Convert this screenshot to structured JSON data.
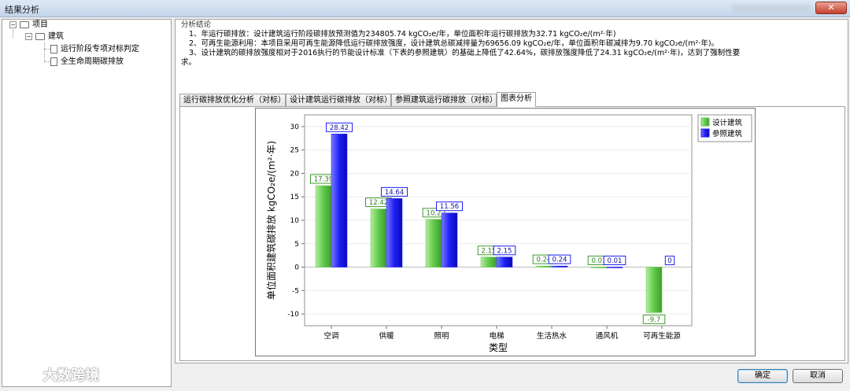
{
  "window": {
    "title": "结果分析",
    "close_label": "✕"
  },
  "tree": {
    "root": "项目",
    "building": "建筑",
    "items": [
      "运行阶段专项对标判定",
      "全生命周期碳排放"
    ]
  },
  "summary": {
    "heading": "分析结论",
    "lines": [
      "1、年运行碳排放：设计建筑运行阶段碳排放预测值为234805.74 kgCO₂e/年，单位面积年运行碳排放为32.71 kgCO₂e/(m²·年)",
      "2、可再生能源利用：本项目采用可再生能源降低运行碳排放强度，设计建筑总碳减排量为69656.09 kgCO₂e/年，单位面积年碳减排为9.70 kgCO₂e/(m²·年)。",
      "3、设计建筑的碳排放强度相对于2016执行的节能设计标准（下表的参照建筑）的基础上降低了42.64%，碳排放强度降低了24.31 kgCO₂e/(m²·年)，达到了强制性要",
      "求。"
    ]
  },
  "tabs": [
    "运行碳排放优化分析（对标）",
    "设计建筑运行碳排放（对标）",
    "参照建筑运行碳排放（对标）",
    "图表分析"
  ],
  "active_tab": 3,
  "buttons": {
    "ok": "确定",
    "cancel": "取消"
  },
  "watermark": {
    "text": "大数跨境"
  },
  "colors": {
    "design": "#5fc94a",
    "reference": "#1f1ff5"
  },
  "chart_data": {
    "type": "bar",
    "categories": [
      "空调",
      "供暖",
      "照明",
      "电梯",
      "生活热水",
      "通风机",
      "可再生能源"
    ],
    "series": [
      {
        "name": "设计建筑",
        "values": [
          17.39,
          12.42,
          10.2,
          2.15,
          0.24,
          0.01,
          -9.7
        ]
      },
      {
        "name": "参照建筑",
        "values": [
          28.42,
          14.64,
          11.56,
          2.15,
          0.24,
          0.01,
          0
        ]
      }
    ],
    "xlabel": "类型",
    "ylabel": "单位面积建筑碳排放 kgCO₂e/(m²·年)",
    "ylim": [
      -12.5,
      32.5
    ],
    "yticks": [
      30,
      25,
      20,
      15,
      10,
      5,
      0,
      -5,
      -10
    ],
    "ytick_labels": [
      "30",
      "25",
      "20",
      "15",
      "10",
      "5",
      "0",
      "-5",
      "-10"
    ],
    "legend_position": "top-right",
    "grid": true
  }
}
